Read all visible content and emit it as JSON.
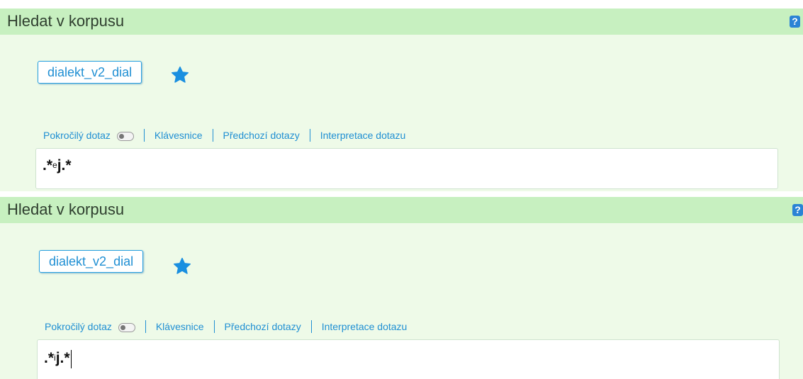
{
  "panels": [
    {
      "header_title": "Hledat v korpusu",
      "help_label": "?",
      "corpus": "dialekt_v2_dial",
      "links": {
        "advanced": "Pokročilý dotaz",
        "keyboard": "Klávesnice",
        "history": "Předchozí dotazy",
        "interpretation": "Interpretace dotazu"
      },
      "query": {
        "pre": ".*",
        "mid": "e",
        "post": "j.*"
      }
    },
    {
      "header_title": "Hledat v korpusu",
      "help_label": "?",
      "corpus": "dialekt_v2_dial",
      "links": {
        "advanced": "Pokročilý dotaz",
        "keyboard": "Klávesnice",
        "history": "Předchozí dotazy",
        "interpretation": "Interpretace dotazu"
      },
      "query": {
        "pre": ".*",
        "mid": "i",
        "post": "j.*"
      }
    }
  ],
  "icons": {
    "star": "star-icon",
    "help": "help-icon",
    "toggle": "toggle-switch"
  },
  "colors": {
    "header_bg": "#c7f0c0",
    "panel_bg": "#eefae8",
    "accent": "#1f8fd3",
    "star": "#1a8fe0"
  }
}
